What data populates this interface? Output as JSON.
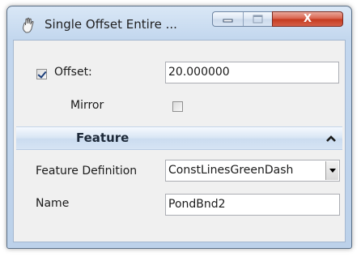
{
  "window": {
    "title": "Single Offset Entire ...",
    "close_label": "X"
  },
  "offset": {
    "label": "Offset:",
    "checked": true,
    "value": "20.000000"
  },
  "mirror": {
    "label": "Mirror",
    "checked": false
  },
  "feature": {
    "title": "Feature",
    "definition_label": "Feature Definition",
    "definition_value": "ConstLinesGreenDash",
    "name_label": "Name",
    "name_value": "PondBnd2"
  }
}
